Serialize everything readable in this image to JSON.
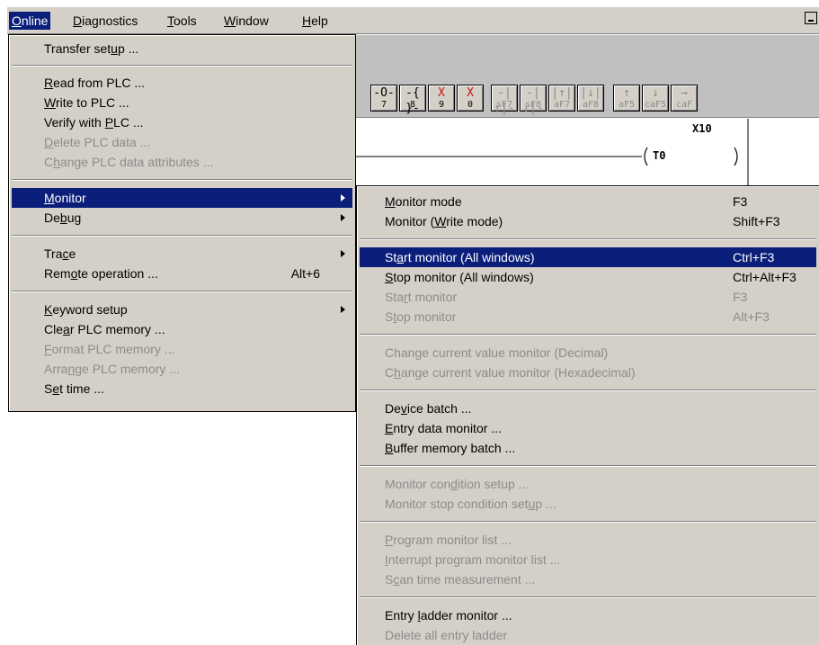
{
  "menubar": {
    "items": [
      {
        "label": "Online",
        "active": true
      },
      {
        "label": "Diagnostics"
      },
      {
        "label": "Tools"
      },
      {
        "label": "Window"
      },
      {
        "label": "Help"
      }
    ]
  },
  "toolbar": {
    "buttons": [
      {
        "sym": "-O-",
        "key": "7"
      },
      {
        "sym": "-{ }-",
        "key": "8"
      },
      {
        "sym": "X",
        "key": "9"
      },
      {
        "sym": "X",
        "key": "0"
      },
      {
        "sym": "-|↑|-",
        "key": "sF7"
      },
      {
        "sym": "-|↓|-",
        "key": "sF8"
      },
      {
        "sym": "|↑|",
        "key": "aF7"
      },
      {
        "sym": "|↓|",
        "key": "aF8"
      },
      {
        "sym": "↑",
        "key": "aF5"
      },
      {
        "sym": "↓",
        "key": "caF5"
      },
      {
        "sym": "→",
        "key": "caF"
      }
    ]
  },
  "ladder": {
    "contact": "X10",
    "coil": "T0"
  },
  "online_menu": {
    "items": [
      {
        "label": "Transfer setup ..."
      },
      {
        "label": "Read from PLC ..."
      },
      {
        "label": "Write to PLC ..."
      },
      {
        "label": "Verify with PLC ..."
      },
      {
        "label": "Delete PLC data ...",
        "disabled": true
      },
      {
        "label": "Change PLC data attributes ...",
        "disabled": true
      },
      {
        "label": "Monitor",
        "submenu": true,
        "selected": true
      },
      {
        "label": "Debug",
        "submenu": true
      },
      {
        "label": "Trace",
        "submenu": true
      },
      {
        "label": "Remote operation ...",
        "accel": "Alt+6"
      },
      {
        "label": "Keyword setup",
        "submenu": true
      },
      {
        "label": "Clear PLC memory ..."
      },
      {
        "label": "Format PLC memory ...",
        "disabled": true
      },
      {
        "label": "Arrange PLC memory ...",
        "disabled": true
      },
      {
        "label": "Set time ..."
      }
    ]
  },
  "monitor_submenu": {
    "items": [
      {
        "label": "Monitor mode",
        "accel": "F3"
      },
      {
        "label": "Monitor (Write mode)",
        "accel": "Shift+F3"
      },
      {
        "label": "Start monitor (All windows)",
        "accel": "Ctrl+F3",
        "selected": true
      },
      {
        "label": "Stop monitor (All windows)",
        "accel": "Ctrl+Alt+F3"
      },
      {
        "label": "Start monitor",
        "accel": "F3",
        "disabled": true
      },
      {
        "label": "Stop monitor",
        "accel": "Alt+F3",
        "disabled": true
      },
      {
        "label": "Change current value monitor (Decimal)",
        "disabled": true
      },
      {
        "label": "Change current value monitor (Hexadecimal)",
        "disabled": true
      },
      {
        "label": "Device batch ..."
      },
      {
        "label": "Entry data monitor ..."
      },
      {
        "label": "Buffer memory batch ..."
      },
      {
        "label": "Monitor condition setup ...",
        "disabled": true
      },
      {
        "label": "Monitor stop condition setup ...",
        "disabled": true
      },
      {
        "label": "Program monitor list ...",
        "disabled": true
      },
      {
        "label": "Interrupt program monitor list ...",
        "disabled": true
      },
      {
        "label": "Scan time measurement ...",
        "disabled": true
      },
      {
        "label": "Entry ladder monitor ..."
      },
      {
        "label": "Delete all entry ladder",
        "disabled": true
      }
    ]
  },
  "colors": {
    "menu_bg": "#d4d0c8",
    "highlight": "#0a1e7a",
    "disabled_text": "#8c8c8c"
  }
}
